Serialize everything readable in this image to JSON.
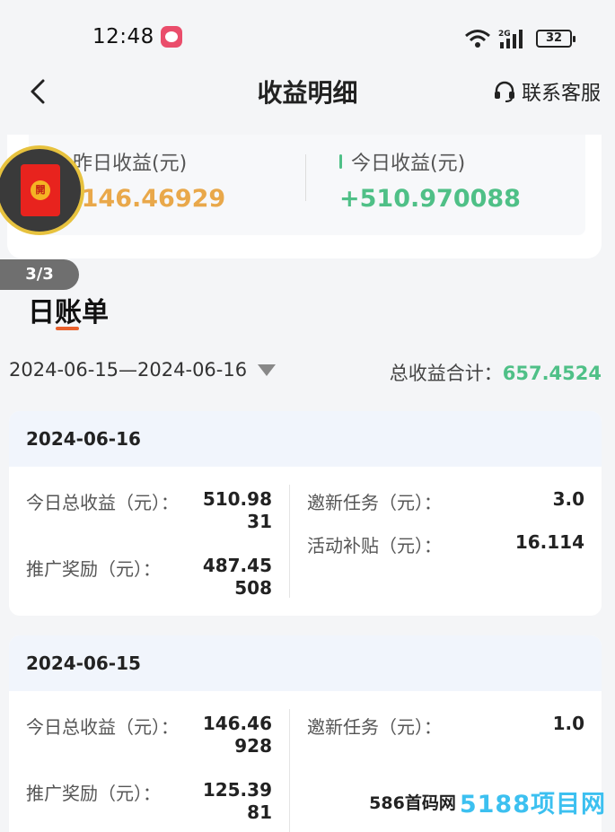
{
  "status": {
    "time": "12:48",
    "battery": "32",
    "network": "2G"
  },
  "nav": {
    "title": "收益明细",
    "contact": "联系客服"
  },
  "summary": {
    "yesterday_label": "昨日收益(元)",
    "yesterday_value": "+146.46929",
    "today_label": "今日收益(元)",
    "today_value": "+510.970088"
  },
  "redpacket": {
    "seal": "開"
  },
  "badge": "3/3",
  "section_title": "日账单",
  "filter": {
    "date_range": "2024-06-15—2024-06-16",
    "total_label": "总收益合计：",
    "total_value": "657.4524"
  },
  "days": [
    {
      "date": "2024-06-16",
      "total_label": "今日总收益（元）：",
      "total_line1": "510.98",
      "total_line2": "31",
      "promo_label": "推广奖励（元）：",
      "promo_line1": "487.45",
      "promo_line2": "508",
      "invite_label": "邀新任务（元）：",
      "invite_value": "3.0",
      "subsidy_label": "活动补贴（元）：",
      "subsidy_value": "16.114"
    },
    {
      "date": "2024-06-15",
      "total_label": "今日总收益（元）：",
      "total_line1": "146.46",
      "total_line2": "928",
      "promo_label": "推广奖励（元）：",
      "promo_line1": "125.39",
      "promo_line2": "81",
      "invite_label": "邀新任务（元）：",
      "invite_value": "1.0"
    }
  ],
  "watermark": {
    "text": "586首码网",
    "logo": "5188项目网"
  },
  "colors": {
    "yesterday": "#e9a84a",
    "today": "#4fc087",
    "accent": "#e8602c"
  }
}
